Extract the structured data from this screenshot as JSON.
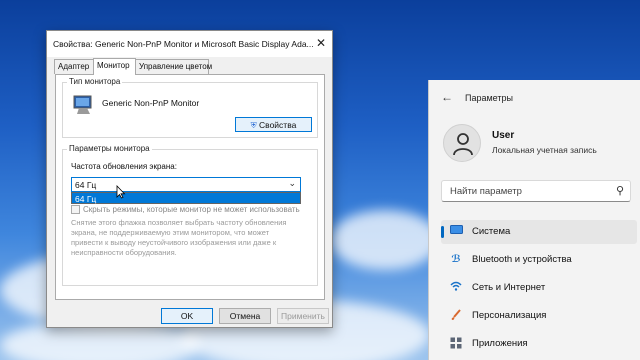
{
  "settings": {
    "title": "Параметры",
    "user_name": "User",
    "user_subtitle": "Локальная учетная запись",
    "search_placeholder": "Найти параметр",
    "nav": [
      {
        "label": "Система",
        "icon": "monitor-icon",
        "color": "#2a7bd6",
        "selected": true
      },
      {
        "label": "Bluetooth и устройства",
        "icon": "bluetooth-icon",
        "color": "#1a73c9",
        "selected": false
      },
      {
        "label": "Сеть и Интернет",
        "icon": "wifi-icon",
        "color": "#1a73c9",
        "selected": false
      },
      {
        "label": "Персонализация",
        "icon": "brush-icon",
        "color": "#d9692f",
        "selected": false
      },
      {
        "label": "Приложения",
        "icon": "apps-icon",
        "color": "#5b6575",
        "selected": false
      }
    ]
  },
  "dialog": {
    "title": "Свойства: Generic Non-PnP Monitor и Microsoft Basic Display Ada...",
    "tabs": [
      "Адаптер",
      "Монитор",
      "Управление цветом"
    ],
    "active_tab": "Монитор",
    "monitor_type": {
      "group_label": "Тип монитора",
      "monitor_name": "Generic Non-PnP Monitor",
      "properties_button": "Свойства"
    },
    "monitor_settings": {
      "group_label": "Параметры монитора",
      "refresh_label": "Частота обновления экрана:",
      "refresh_value": "64 Гц",
      "dropdown_option": "64 Гц",
      "hide_modes_label": "Скрыть режимы, которые монитор не может использовать",
      "hide_modes_checked": false,
      "note": "Снятие этого флажка позволяет выбрать частоту обновления экрана, не поддерживаемую этим монитором, что может привести к выводу неустойчивого изображения или даже к неисправности оборудования."
    },
    "buttons": {
      "ok": "OK",
      "cancel": "Отмена",
      "apply": "Применить"
    }
  },
  "colors": {
    "accent": "#0078d7",
    "win11_accent": "#0067c0"
  }
}
